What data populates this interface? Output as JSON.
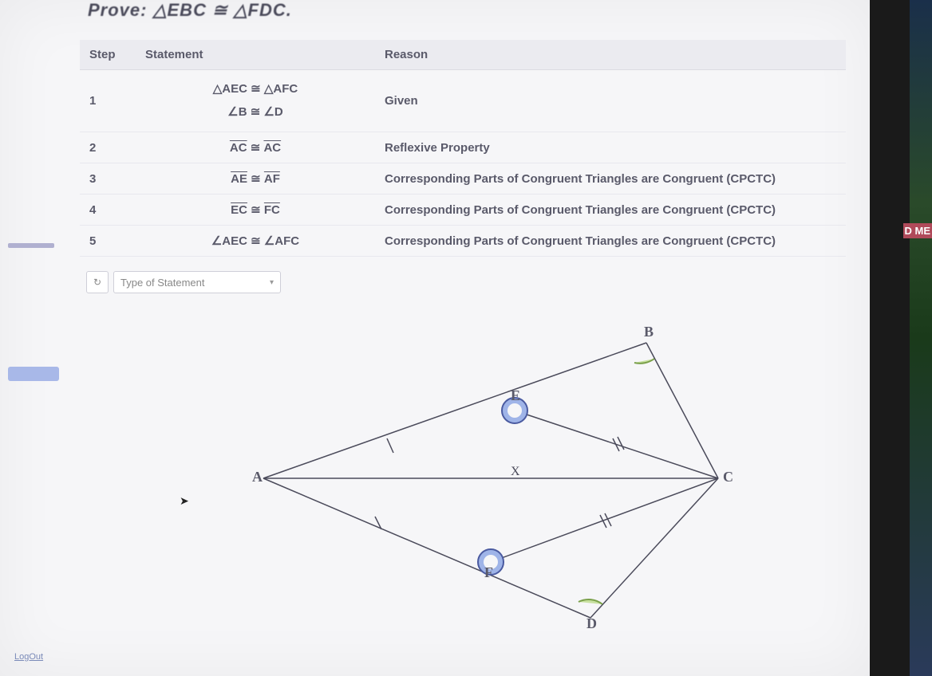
{
  "prove": "Prove: △EBC ≅ △FDC.",
  "headers": {
    "step": "Step",
    "statement": "Statement",
    "reason": "Reason"
  },
  "rows": [
    {
      "step": "1",
      "stmt_a": "△AEC ≅ △AFC",
      "stmt_b": "∠B ≅ ∠D",
      "reason": "Given"
    },
    {
      "step": "2",
      "stmt_seg_a": "AC",
      "stmt_seg_b": "AC",
      "reason": "Reflexive Property"
    },
    {
      "step": "3",
      "stmt_seg_a": "AE",
      "stmt_seg_b": "AF",
      "reason": "Corresponding Parts of Congruent Triangles are Congruent (CPCTC)"
    },
    {
      "step": "4",
      "stmt_seg_a": "EC",
      "stmt_seg_b": "FC",
      "reason": "Corresponding Parts of Congruent Triangles are Congruent (CPCTC)"
    },
    {
      "step": "5",
      "stmt_a": "∠AEC ≅ ∠AFC",
      "reason": "Corresponding Parts of Congruent Triangles are Congruent (CPCTC)"
    }
  ],
  "toolbar": {
    "reset_glyph": "↻",
    "select_placeholder": "Type of Statement"
  },
  "vertices": {
    "A": "A",
    "B": "B",
    "C": "C",
    "D": "D",
    "E": "E",
    "F": "F"
  },
  "tick_label": "X",
  "side_badge": "D ME",
  "footer_link": "LogOut"
}
